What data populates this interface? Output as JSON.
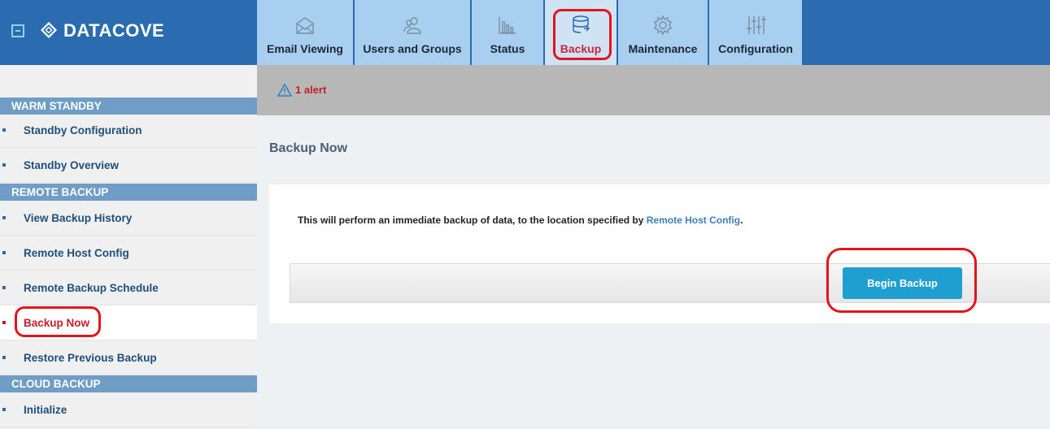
{
  "brand": {
    "name": "DATACOVE"
  },
  "tabs": [
    {
      "label": "Email Viewing",
      "icon": "envelope-icon"
    },
    {
      "label": "Users and Groups",
      "icon": "users-icon"
    },
    {
      "label": "Status",
      "icon": "bar-chart-icon"
    },
    {
      "label": "Backup",
      "icon": "database-backup-icon",
      "active": true
    },
    {
      "label": "Maintenance",
      "icon": "gear-icon"
    },
    {
      "label": "Configuration",
      "icon": "sliders-icon"
    }
  ],
  "alert": {
    "text": "1 alert",
    "icon": "warning-triangle-icon"
  },
  "sidebar": {
    "sections": [
      {
        "title": "WARM STANDBY",
        "items": [
          "Standby Configuration",
          "Standby Overview"
        ]
      },
      {
        "title": "REMOTE BACKUP",
        "items": [
          "View Backup History",
          "Remote Host Config",
          "Remote Backup Schedule",
          "Backup Now",
          "Restore Previous Backup"
        ]
      },
      {
        "title": "CLOUD BACKUP",
        "items": [
          "Initialize"
        ]
      }
    ],
    "active_item": "Backup Now"
  },
  "main": {
    "title": "Backup Now",
    "description_before": "This will perform an immediate backup of data, to the location specified by ",
    "description_link": "Remote Host Config",
    "description_after": ".",
    "button_label": "Begin Backup"
  },
  "colors": {
    "header_blue": "#2b6cb0",
    "tab_bg": "#a9cff0",
    "accent_red": "#c3202b",
    "button_blue": "#1f9fd0",
    "highlight_red": "#e3141b"
  }
}
